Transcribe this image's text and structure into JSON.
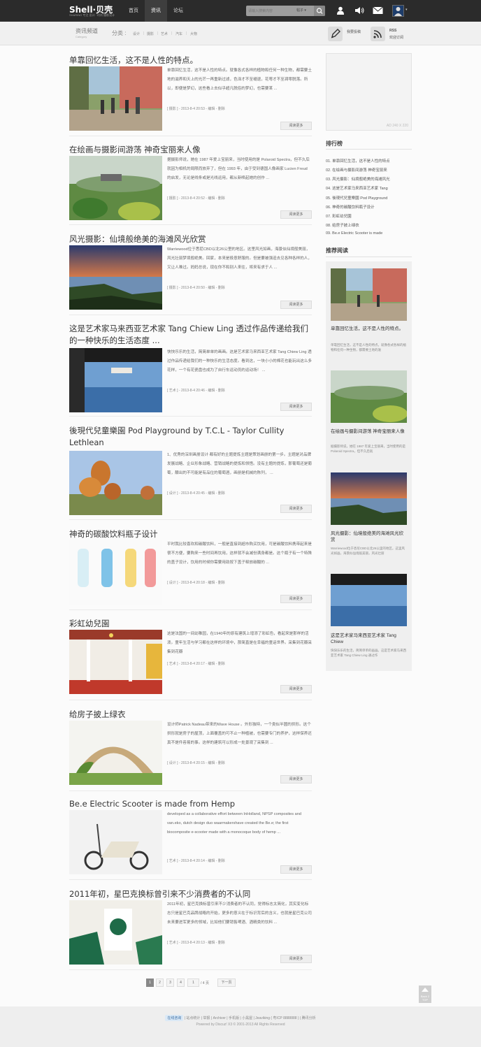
{
  "header": {
    "logo": "Shell·贝壳",
    "logo_sub": "SHARING 专注 设计 · 时尚 摄影设计",
    "nav": [
      {
        "label": "首页"
      },
      {
        "label": "资讯"
      },
      {
        "label": "论坛"
      }
    ],
    "search_placeholder": "请输入搜索内容",
    "search_type": "帖子",
    "icons": [
      "user-icon",
      "speaker-icon",
      "mail-icon",
      "avatar"
    ]
  },
  "channel": {
    "title": "资讯频道",
    "sub": "Category",
    "fenlei": "分类 :",
    "categories": [
      "设计",
      "摄影",
      "艺术",
      "汽车",
      "大物"
    ],
    "submit_label": "我要投稿",
    "rss_label": "RSS",
    "rss_sub": "欢迎订阅"
  },
  "articles": [
    {
      "title": "单靠回忆生活，这不是人性的特点。",
      "excerpt": "单靠回忆生活，这不是人性的特点。就像各式各样的植物和任何一种生物，都需要土地的滋养和天上的光芒一再重新过滤，色泽才不至褪退，花萼才不至凋零脱落。所以，即便是梦幻，这些看上去似乎超凡脱俗的梦幻，也需要某 ...",
      "meta": "[ 摄影 ] - 2013-8-4 20:53 - 编辑 - 删除",
      "more": "阅读更多"
    },
    {
      "title": "在绘画与摄影间游荡 神奇宝丽来人像",
      "excerpt": "据摄影师说，她在 1987 年爱上宝丽来，当时使用的是 Polaroid Spectra，但不久后就因为相机的局限而放弃了，但在 1993 年，由于受到德国人像画家 Lucien Freud 的启发，无论是线条或是光线运用，都从新唤起她的创作 ...",
      "meta": "[ 摄影 ] - 2013-8-4 20:52 - 编辑 - 删除",
      "more": "阅读更多"
    },
    {
      "title": "风光摄影：仙境般绝美的海滩风光欣赏",
      "excerpt": "Warriewood位于悉尼CBD以北26公里的地区。这里风光如画，海景似仙境般美丽，风光壮丽梦境般绝美。回家，本来是极意舒服的。但是要被强迫去见各种各样的人，又让人难过。妈妈总说，现在你不和别人来往，将来有求于人 ...",
      "meta": "[ 摄影 ] - 2013-8-4 20:50 - 编辑 - 删除",
      "more": "阅读更多"
    },
    {
      "title": "这是艺术家马来西亚艺术家 Tang Chiew Ling 透过作品传递给我们的一种快乐的生活态度 ...",
      "excerpt": "快快乐乐的生活，简简单单的画画。这是艺术家马来西亚艺术家 Tang Chiew Ling 透过作品传递给我们的一种快乐的生活态度。看到这，一块小小的棉花也能玩出这么多花样，一个有花瓷盘也成为了自行车运动员的运动场！ ...",
      "meta": "[ 艺术 ] - 2013-8-4 20:46 - 编辑 - 删除",
      "more": "阅读更多"
    },
    {
      "title": "後現代兒童樂園 Pod Playground by T.C.L - Taylor Cullity Lethlean",
      "excerpt": "1、优秀的深圳画册设计 都有好的主题提炼主题是策划画册的第一步。主题是对品牌发展战略、企业形象战略、营销战略的提炼和领悟。没有主题的提炼，那葡萄还是葡萄，酿出的不可能是有品位的葡萄酒，画册是机械的陈列， ...",
      "meta": "[ 设计 ] - 2013-8-4 20:45 - 编辑 - 删除",
      "more": "阅读更多"
    },
    {
      "title": "神奇的碳酸饮料瓶子设计",
      "excerpt": "平时我比较喜欢和碳酸饮料，一般是直接到超市购买饮用，可是碳酸饮料携带起来是很不方便，要购来一些时间再饮用，这样就不会减份满身都是。这个瓶子有一个特殊的盖子设计，饮用的时候你需要用劲按下盖子释放碳酸的 ...",
      "meta": "[ 设计 ] - 2013-8-4 20:18 - 编辑 - 删除",
      "more": "阅读更多"
    },
    {
      "title": "彩虹幼兒園",
      "excerpt": "这是法国的一间幼稚园，在1940年的原有建筑上增添了彩虹色，看起来是那样的活泼。童年生活与学习都在这样的环境中，那简直是在幸福的童话世界。采集到花瓣采集到花瓣",
      "meta": "[ 艺术 ] - 2013-8-4 20:17 - 编辑 - 删除",
      "more": "阅读更多"
    },
    {
      "title": "给房子披上绿衣",
      "excerpt": "设计师Patrick Nadeau带来的Wave House 。外形独特，一个类似半圆的拱形。这个拱形就是房子的屋顶，上面覆盖的可不止一种植被，也需要专门的养护，这样保养还真不是件容易的事。这样的建筑可以形成一处景观了采集到 ...",
      "meta": "[ 设计 ] - 2013-8-4 20:15 - 编辑 - 删除",
      "more": "阅读更多"
    },
    {
      "title": "Be.e Electric Scooter is made from Hemp",
      "excerpt": "developed as a collaborative effort between InHolland, NPSP composites and van.eko, dutch design duo waarmakershave created the Be.e; the first biocomposite e-scooter made with a monocoque body of hemp ...",
      "meta": "[ 艺术 ] - 2013-8-4 20:14 - 编辑 - 删除",
      "more": "阅读更多"
    },
    {
      "title": "2011年初，星巴克换标曾引来不少消费者的不认同",
      "excerpt": "2011年初，星巴克换标曾引来不少消费者的不认同，觉得标志太简化，其实变化标志只是星巴克品牌战略的开始，更多的意义在于标识背后的含义，也就是星巴克公司未来要进军更多的领域，比如他们要销售啤酒、酒精类的饮料 ...",
      "meta": "[ 艺术 ] - 2013-8-4 20:13 - 编辑 - 删除",
      "more": "阅读更多"
    }
  ],
  "pagination": {
    "pages": [
      "1",
      "2",
      "3",
      "4"
    ],
    "input_value": "1",
    "total": "/ 4 页",
    "next": "下一页"
  },
  "sidebar": {
    "ad": "AD 240 X 220",
    "ranking_title": "排行榜",
    "ranking": [
      "01. 单靠回忆生活，这不是人性的特点",
      "02. 在绘画与摄影间游荡 神奇宝丽来",
      "03. 风光摄影：仙境般绝美的海滩风光",
      "04. 这是艺术家马来西亚艺术家 Tang",
      "05. 後現代兒童樂園 Pod Playground",
      "06. 神奇的碳酸饮料瓶子设计",
      "07. 彩虹幼兒園",
      "08. 给房子披上绿衣",
      "09. Be.e Electric Scooter is made"
    ],
    "recommend_title": "推荐阅读",
    "recommend": [
      {
        "title": "单靠回忆生活，这不是人性的特点。",
        "desc": "单靠回忆生活，这不是人性的特点。就像各式各样的植物和任何一种生物，都需要土地的滋"
      },
      {
        "title": "在绘画与摄影间游荡 神奇宝丽来人像",
        "desc": "据摄影师说，她在 1987 年爱上宝丽来，当时使用的是 Polaroid Spectra，但不久后就"
      },
      {
        "title": "风光摄影：仙境般绝美的海滩风光欣赏",
        "desc": "Warriewood位于悉尼CBD以北26公里的地区。这里风光如画，海景似仙境般美丽，风光壮丽"
      },
      {
        "title": "这是艺术家马来西亚艺术家 Tang Chiew",
        "desc": "快快乐乐的生活，简简单单的画画。这是艺术家马来西亚艺术家 Tang Chiew Ling 通过作"
      }
    ]
  },
  "back_to_top": "Back 2 TOP",
  "footer": {
    "badge": "在线咨询",
    "links": "| 站点统计 | 举报 | Archiver | 手机版 | 小黑屋 | Jeaviking ( 粤ICP 8888888 ) | 腾讯分析",
    "copy": "Powered by Discuz! X3 © 2001-2013 All Rights Reserved"
  }
}
